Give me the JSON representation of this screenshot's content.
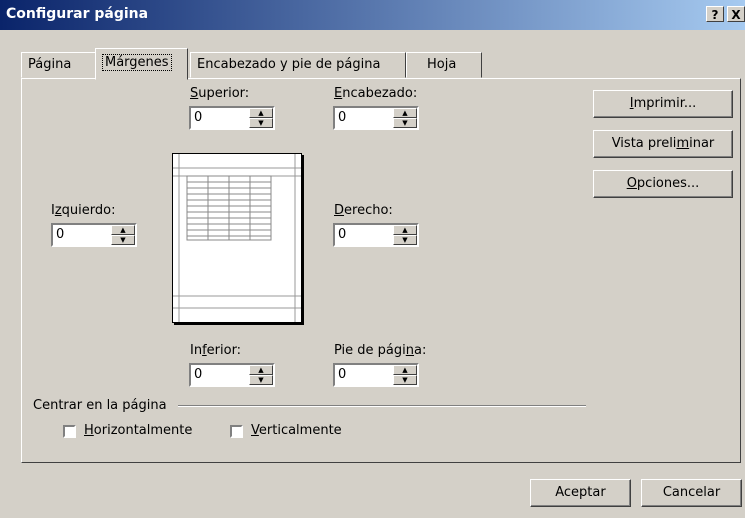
{
  "window": {
    "title": "Configurar página",
    "help_button": "?",
    "close_button": "X"
  },
  "tabs": [
    {
      "label": "Página",
      "active": false
    },
    {
      "label": "Márgenes",
      "active": true
    },
    {
      "label": "Encabezado y pie de página",
      "active": false
    },
    {
      "label": "Hoja",
      "active": false
    }
  ],
  "margins": {
    "superior": {
      "label_pre": "",
      "label_key": "S",
      "label_post": "uperior:",
      "value": "0"
    },
    "encabezado": {
      "label_pre": "",
      "label_key": "E",
      "label_post": "ncabezado:",
      "value": "0"
    },
    "izquierdo": {
      "label_pre": "I",
      "label_key": "z",
      "label_post": "quierdo:",
      "value": "0"
    },
    "derecho": {
      "label_pre": "",
      "label_key": "D",
      "label_post": "erecho:",
      "value": "0"
    },
    "inferior": {
      "label_pre": "In",
      "label_key": "f",
      "label_post": "erior:",
      "value": "0"
    },
    "pie": {
      "label_pre": "Pie de pági",
      "label_key": "n",
      "label_post": "a:",
      "value": "0"
    }
  },
  "centrar": {
    "title": "Centrar en la página",
    "horizontal": {
      "label_key": "H",
      "label_post": "orizontalmente",
      "checked": false
    },
    "vertical": {
      "label_key": "V",
      "label_post": "erticalmente",
      "checked": false
    }
  },
  "side_buttons": {
    "imprimir": {
      "pre": "",
      "key": "I",
      "post": "mprimir..."
    },
    "vista": {
      "pre": "Vista preli",
      "key": "m",
      "post": "inar"
    },
    "opciones": {
      "pre": "",
      "key": "O",
      "post": "pciones..."
    }
  },
  "footer": {
    "accept": "Aceptar",
    "cancel": "Cancelar"
  }
}
